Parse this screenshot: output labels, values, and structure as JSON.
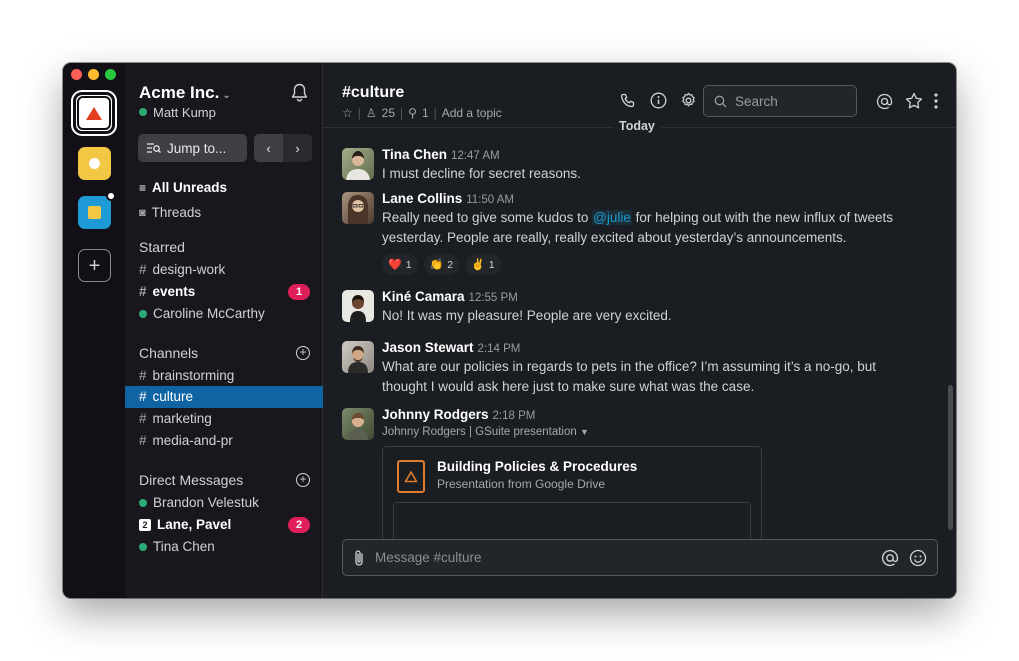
{
  "colors": {
    "rail_bg": "#121016",
    "sidebar_bg": "#19171d",
    "main_bg": "#1a1d21",
    "selected_channel": "#1164a3",
    "badge_red": "#e01e5a",
    "presence_green": "#2bac76",
    "mention_blue": "#1d9bd1",
    "window_close": "#fe5f57",
    "window_minimize": "#febc2e",
    "window_zoom": "#28c840"
  },
  "rail": {
    "workspaces": [
      {
        "name": "acme-workspace",
        "icon": "red-triangle-icon"
      },
      {
        "name": "yellow-workspace",
        "icon": "white-dot-icon"
      },
      {
        "name": "blue-workspace",
        "icon": "yellow-square-icon"
      }
    ],
    "add_icon": "plus-icon"
  },
  "sidebar": {
    "team_name": "Acme Inc.",
    "user_name": "Matt Kump",
    "jump_label": "Jump to...",
    "all_unreads": "All Unreads",
    "threads": "Threads",
    "starred_title": "Starred",
    "starred": [
      {
        "label": "design-work",
        "bold": false
      },
      {
        "label": "events",
        "bold": true,
        "badge": "1"
      },
      {
        "label": "Caroline McCarthy",
        "dm": true
      }
    ],
    "channels_title": "Channels",
    "channels": [
      {
        "label": "brainstorming"
      },
      {
        "label": "culture",
        "selected": true
      },
      {
        "label": "marketing"
      },
      {
        "label": "media-and-pr"
      }
    ],
    "dms_title": "Direct Messages",
    "dms": [
      {
        "label": "Brandon Velestuk"
      },
      {
        "label": "Lane, Pavel",
        "group_count": "2",
        "badge": "2"
      },
      {
        "label": "Tina Chen"
      }
    ]
  },
  "header": {
    "channel": "#culture",
    "members": "25",
    "pins": "1",
    "topic": "Add a topic",
    "search_placeholder": "Search",
    "date_divider": "Today"
  },
  "messages": [
    {
      "name": "Tina Chen",
      "time": "12:47 AM",
      "text": "I must decline for secret reasons."
    },
    {
      "name": "Lane Collins",
      "time": "11:50 AM",
      "text_before": "Really need to give some kudos to ",
      "mention": "@julie",
      "text_after": " for helping out with the new influx of tweets",
      "text_line2": "yesterday. People are really, really excited about yesterday’s announcements.",
      "reactions": [
        {
          "emoji": "❤️",
          "count": "1"
        },
        {
          "emoji": "👏",
          "count": "2"
        },
        {
          "emoji": "✌️",
          "count": "1"
        }
      ]
    },
    {
      "name": "Kiné Camara",
      "time": "12:55 PM",
      "text": "No! It was my pleasure! People are very excited."
    },
    {
      "name": "Jason Stewart",
      "time": "2:14 PM",
      "text": "What are our policies in regards to pets in the office? I’m assuming it’s a no-go, but",
      "text_line2": "thought I would ask here just to make sure what was the case."
    },
    {
      "name": "Johnny Rodgers",
      "time": "2:18 PM",
      "attachment_meta": "Johnny Rodgers | GSuite presentation",
      "card_title": "Building Policies & Procedures",
      "card_subtitle": "Presentation from Google Drive"
    }
  ],
  "composer": {
    "placeholder": "Message #culture"
  }
}
